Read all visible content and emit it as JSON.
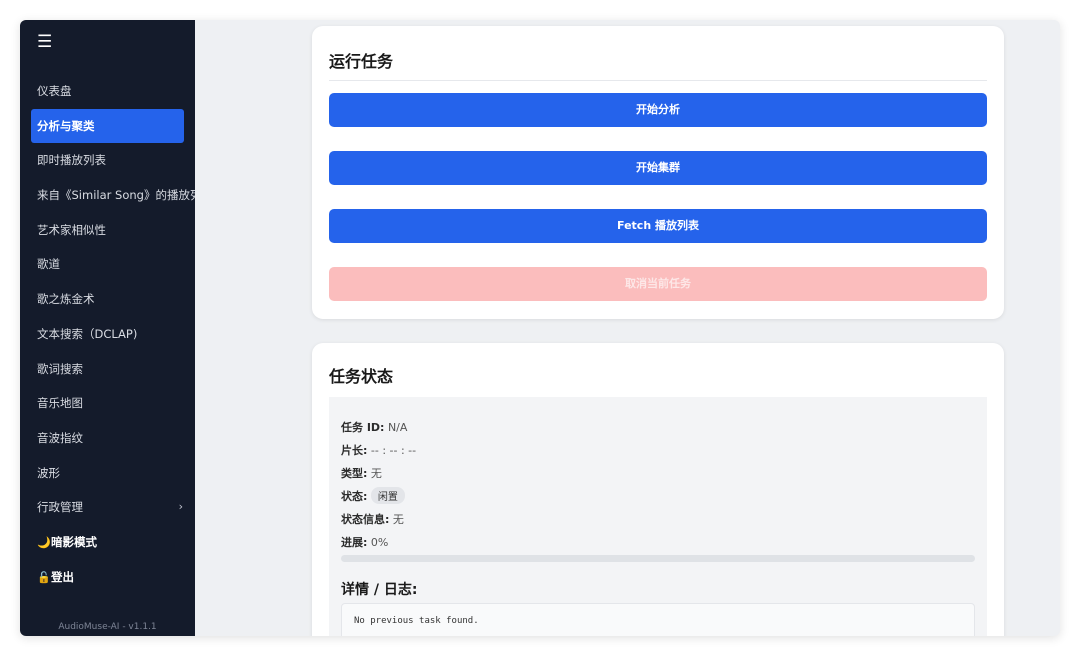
{
  "sidebar": {
    "menu_icon": "menu-icon",
    "items": [
      {
        "label": "仪表盘"
      },
      {
        "label": "分析与聚类",
        "active": true
      },
      {
        "label": "即时播放列表"
      },
      {
        "label": "来自《Similar Song》的播放列表"
      },
      {
        "label": "艺术家相似性"
      },
      {
        "label": "歌道"
      },
      {
        "label": "歌之炼金术"
      },
      {
        "label": "文本搜索（DCLAP)"
      },
      {
        "label": "歌词搜索"
      },
      {
        "label": "音乐地图"
      },
      {
        "label": "音波指纹"
      },
      {
        "label": "波形"
      },
      {
        "label": "行政管理",
        "chevron": "›"
      },
      {
        "label": "暗影模式",
        "icon": "🌙"
      },
      {
        "label": "登出",
        "icon": "🔓"
      }
    ],
    "version": "AudioMuse-AI - v1.1.1"
  },
  "run_tasks": {
    "title": "运行任务",
    "start_analysis": "开始分析",
    "start_clustering": "开始集群",
    "fetch_playlists": "Fetch 播放列表",
    "cancel_task": "取消当前任务"
  },
  "task_status": {
    "title": "任务状态",
    "task_id_label": "任务 ID:",
    "task_id_value": "N/A",
    "duration_label": "片长:",
    "duration_value": "-- : -- : --",
    "type_label": "类型:",
    "type_value": "无",
    "state_label": "状态:",
    "state_value": "闲置",
    "state_info_label": "状态信息:",
    "state_info_value": "无",
    "progress_label": "进展:",
    "progress_value": "0%",
    "progress_fraction": 0,
    "details_title": "详情 / 日志:",
    "log_text": "No previous task found."
  },
  "colors": {
    "sidebar_bg": "#141b2b",
    "accent": "#2563eb",
    "cancel_disabled": "#fbbdbd"
  }
}
